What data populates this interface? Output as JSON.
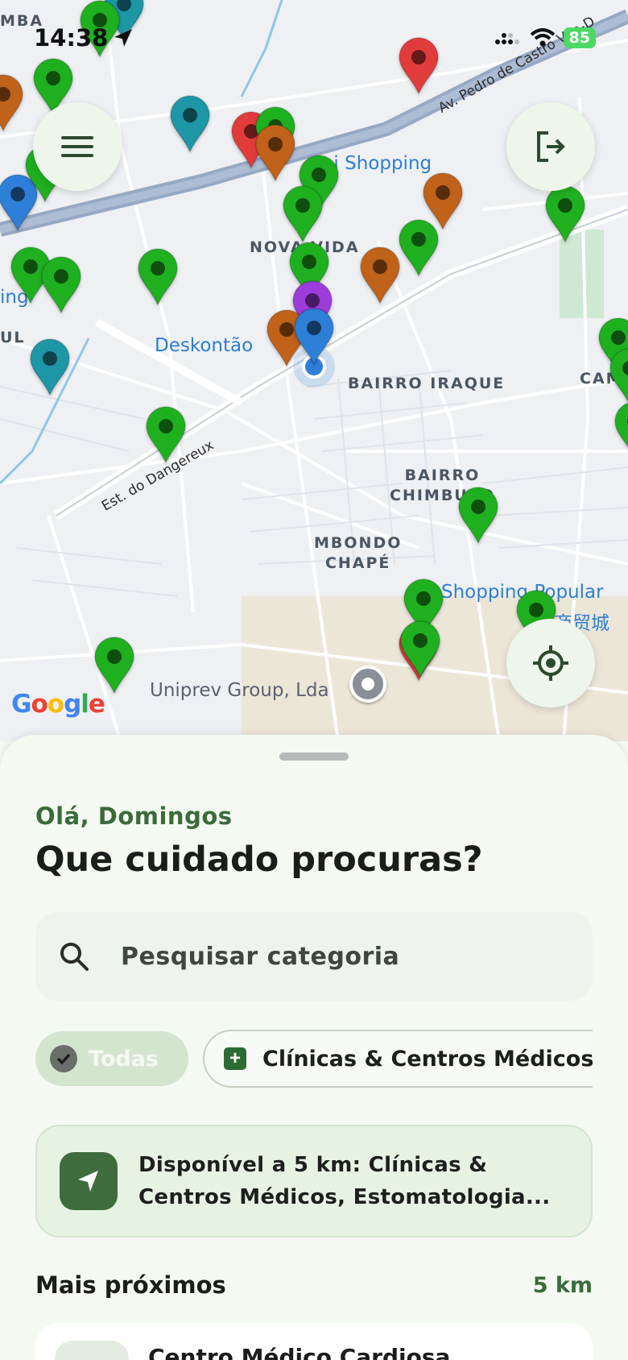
{
  "status_bar": {
    "time": "14:38",
    "battery": "85"
  },
  "map": {
    "area_labels": {
      "mba": "MBA",
      "nova_vida": "NOVA VIDA",
      "bairro_iraque": "BAIRRO IRAQUE",
      "bairro_chimbuto": "BAIRRO\nCHIMBUTO",
      "mbondo_chape": "MBONDO\nCHAPÉ",
      "cam": "CAM",
      "ul": "UL"
    },
    "poi_labels": {
      "shopping": "mi Shopping",
      "deskontao": "Deskontão",
      "shopping_popular": "Shopping Popular",
      "shopping_popular_cn": "商贸城",
      "uniprev": "Uniprev Group, Lda",
      "left_ing": "ing"
    },
    "road_labels": {
      "est_dangereux": "Est. do Dangereux",
      "av_pedro": "Av. Pedro de Castro Van-D"
    },
    "attribution": "Google",
    "pin_colors": {
      "green": "#1fb020",
      "orange": "#c0621a",
      "teal": "#1d96a6",
      "blue": "#2e7fd8",
      "red": "#e23b3b",
      "purple": "#9c3cdb"
    }
  },
  "sheet": {
    "greeting": "Olá, Domingos",
    "headline": "Que cuidado procuras?",
    "search_placeholder": "Pesquisar categoria",
    "chips": {
      "all": "Todas",
      "clinics": "Clínicas & Centros Médicos"
    },
    "notice_line1": "Disponível a 5 km: Clínicas &",
    "notice_line2": "Centros Médicos, Estomatologia...",
    "section_title": "Mais próximos",
    "section_range": "5 km",
    "first_card_title": "Centro Médico Cardiosa..."
  }
}
